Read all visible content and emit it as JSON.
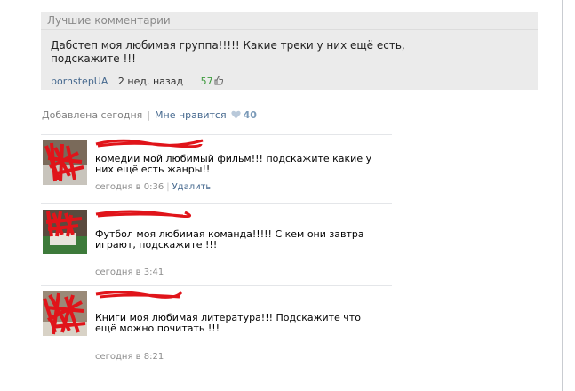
{
  "best_comments": {
    "header": "Лучшие комментарии",
    "text": "Дабстеп моя любимая группа!!!!! Какие треки у них ещё есть, подскажите !!!",
    "author": "pornstepUA",
    "date": "2 нед. назад",
    "likes": "57"
  },
  "post_info": {
    "added": "Добавлена сегодня",
    "separator": "|",
    "like_label": "Мне нравится",
    "like_count": "40"
  },
  "comments": [
    {
      "text": "комедии мой любимый фильм!!! подскажите какие у них ещё есть жанры!!",
      "time": "сегодня в 0:36",
      "separator": "|",
      "delete_label": "Удалить"
    },
    {
      "text": "Футбол моя любимая команда!!!!! С кем они завтра играют, подскажите !!!",
      "time": "сегодня в 3:41"
    },
    {
      "text": "Книги моя любимая литература!!! Подскажите что ещё можно почитать !!!",
      "time": "сегодня в 8:21"
    }
  ],
  "colors": {
    "link": "#45688e",
    "likes_green": "#3c9a3c",
    "box_bg": "#ebebeb",
    "redaction": "#e0141a"
  },
  "icons": [
    "thumbs-up-icon",
    "heart-icon",
    "redacted-avatar",
    "redacted-name"
  ]
}
